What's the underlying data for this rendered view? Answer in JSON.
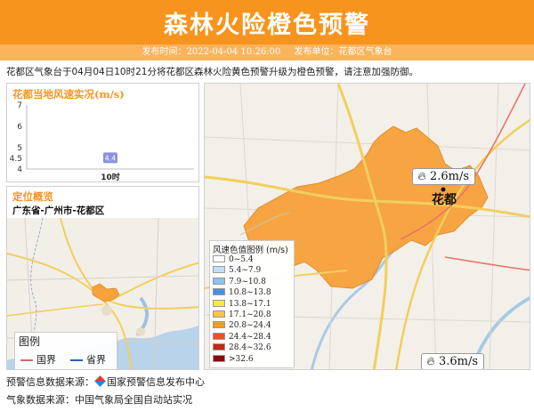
{
  "header": {
    "title": "森林火险橙色预警",
    "publish_time": "发布时间：2022-04-04 10:26:00",
    "publisher": "发布单位：花都区气象台"
  },
  "summary": "花都区气象台于04月04日10时21分将花都区森林火险黄色预警升级为橙色预警，请注意加强防御。",
  "wind_panel": {
    "title": "花都当地风速实况(m/s)",
    "chart_data": {
      "type": "bar",
      "categories": [
        "10时"
      ],
      "values": [
        4.4
      ],
      "data_labels": [
        "4.4"
      ],
      "yticks": [
        "7",
        "6",
        "5",
        "4.5",
        "4"
      ],
      "ylim": [
        4,
        7
      ]
    }
  },
  "location_panel": {
    "title": "定位概览",
    "subtitle": "广东省-广州市-花都区",
    "legend": {
      "title": "图例",
      "items": [
        {
          "label": "国界",
          "color": "#c86f6f"
        },
        {
          "label": "省界",
          "color": "#2e5fb3"
        }
      ]
    }
  },
  "main_map": {
    "place_name": "花都",
    "region_color": "#f7a23a",
    "wind_badges": [
      {
        "value": "2.6m/s",
        "icon": "flame-icon"
      },
      {
        "value": "3.6m/s",
        "icon": "flame-icon"
      }
    ],
    "scale": {
      "title": "风速色值图例 (m/s)",
      "rows": [
        {
          "label": "0~5.4",
          "color": "#ffffff"
        },
        {
          "label": "5.4~7.9",
          "color": "#bfdff7"
        },
        {
          "label": "7.9~10.8",
          "color": "#8cc3f0"
        },
        {
          "label": "10.8~13.8",
          "color": "#4a90e2"
        },
        {
          "label": "13.8~17.1",
          "color": "#f5e94a"
        },
        {
          "label": "17.1~20.8",
          "color": "#f5c542"
        },
        {
          "label": "20.8~24.4",
          "color": "#f39a2e"
        },
        {
          "label": "24.4~28.4",
          "color": "#e8501e"
        },
        {
          "label": "28.4~32.6",
          "color": "#c62814"
        },
        {
          "label": ">32.6",
          "color": "#8b0a0a"
        }
      ]
    }
  },
  "footer": {
    "warning_source_label": "预警信息数据来源：",
    "warning_source_value": "国家预警信息发布中心",
    "weather_source": "气象数据来源：中国气象局全国自动站实况"
  }
}
